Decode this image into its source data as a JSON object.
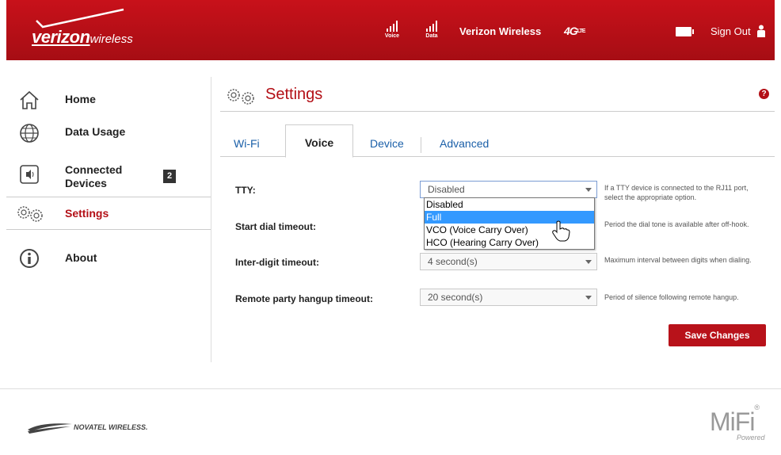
{
  "header": {
    "brand": "verizon",
    "brand_sub": "wireless",
    "signals": [
      {
        "label": "Voice"
      },
      {
        "label": "Data"
      }
    ],
    "carrier": "Verizon Wireless",
    "network": "4G",
    "network_suffix": "LTE",
    "sign_out": "Sign Out"
  },
  "sidebar": {
    "items": [
      {
        "label": "Home",
        "icon": "home-icon"
      },
      {
        "label": "Data Usage",
        "icon": "globe-icon"
      },
      {
        "label": "Connected Devices",
        "icon": "speaker-icon",
        "badge": "2"
      },
      {
        "label": "Settings",
        "icon": "gears-icon",
        "active": true
      },
      {
        "label": "About",
        "icon": "info-icon"
      }
    ]
  },
  "page": {
    "title": "Settings",
    "help": "?"
  },
  "tabs": [
    {
      "label": "Wi-Fi"
    },
    {
      "label": "Voice",
      "active": true
    },
    {
      "label": "Device"
    },
    {
      "label": "Advanced"
    }
  ],
  "form": {
    "tty": {
      "label": "TTY:",
      "value": "Disabled",
      "hint": "If a TTY device is connected to the RJ11 port, select the appropriate option.",
      "options": [
        "Disabled",
        "Full",
        "VCO (Voice Carry Over)",
        "HCO (Hearing Carry Over)"
      ],
      "highlighted": "Full"
    },
    "start_dial": {
      "label": "Start dial timeout:",
      "hint": "Period the dial tone is available after off-hook."
    },
    "inter_digit": {
      "label": "Inter-digit timeout:",
      "value": "4 second(s)",
      "hint": "Maximum interval between digits when dialing."
    },
    "remote_hangup": {
      "label": "Remote party hangup timeout:",
      "value": "20 second(s)",
      "hint": "Period of silence following remote hangup."
    },
    "save": "Save Changes"
  },
  "footer": {
    "novatel": "NOVATEL WIRELESS.",
    "mifi": "MiFi",
    "mifi_mark": "®",
    "powered": "Powered"
  },
  "colors": {
    "brand_red": "#b30f16",
    "link_blue": "#1a5fa8",
    "highlight": "#3399ff"
  }
}
